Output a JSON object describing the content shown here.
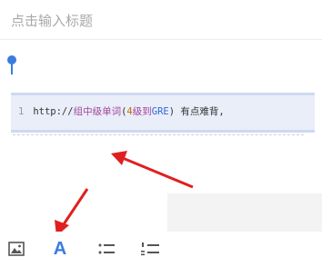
{
  "title_input": {
    "placeholder": "点击输入标题"
  },
  "code": {
    "line_number": "1",
    "prefix": "http://",
    "part1": "组中级单词",
    "paren_open": "(",
    "num": "4",
    "part2": "级到",
    "gre": "GRE",
    "paren_close": ")",
    "suffix": "有点难背,"
  },
  "toolbar": {
    "font_label": "A",
    "items": [
      "image-icon",
      "font-style-icon",
      "bullet-list-icon",
      "numbered-list-icon"
    ]
  },
  "colors": {
    "accent": "#3a7be0",
    "arrow": "#e02020",
    "selection": "#e9eef9"
  }
}
